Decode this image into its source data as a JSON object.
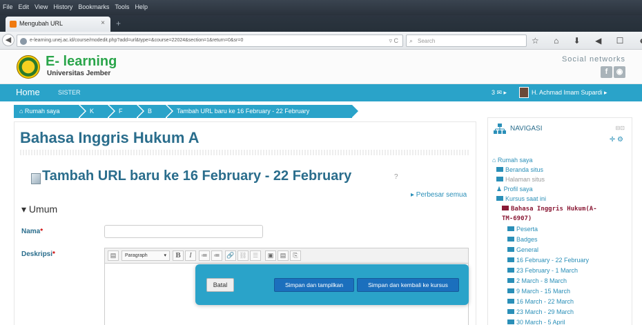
{
  "browser": {
    "menu": [
      "File",
      "Edit",
      "View",
      "History",
      "Bookmarks",
      "Tools",
      "Help"
    ],
    "tab_title": "Mengubah URL",
    "tab_close": "×",
    "new_tab": "+",
    "url": "e-learning.unej.ac.id/course/modedit.php?add=url&type=&course=22024&section=1&return=0&sr=0",
    "search_placeholder": "Search",
    "toolbar_icons": "☆ ⌂ ⬇ ◀ ☐ ☻ ≡"
  },
  "site": {
    "brand_title": "E- learning",
    "brand_subtitle": "Universitas Jember",
    "social_label": "Social networks",
    "social_icons": [
      "f",
      "◉"
    ]
  },
  "sitenav": {
    "home": "Home",
    "sister": "SISTER",
    "messages": "3 ✉ ▸",
    "user": "H. Achmad Imam Supardi ▸"
  },
  "breadcrumb": [
    "⌂ Rumah saya",
    "K",
    "F",
    "B",
    "Tambah URL baru ke 16 February - 22 February"
  ],
  "main": {
    "course_title": "Bahasa Inggris Hukum A",
    "page_title": "Tambah URL baru ke 16 February - 22 February",
    "help_icon": "?",
    "expand_all": "▸ Perbesar semua",
    "section_label": "▾ Umum",
    "name_label": "Nama",
    "desc_label": "Deskripsi",
    "required_mark": "*",
    "editor_format": "Paragraph",
    "editor_buttons": [
      "B",
      "I",
      "≔",
      "≔",
      "🔗",
      "⛓",
      "☰",
      "▣",
      "▤",
      "⎘"
    ]
  },
  "modal": {
    "cancel": "Batal",
    "save_display": "Simpan dan tampilkan",
    "save_return": "Simpan dan kembali ke kursus"
  },
  "navigation": {
    "header": "NAVIGASI",
    "controls": [
      "⊟⊡",
      "✛ ⚙"
    ],
    "items": [
      {
        "label": "⌂ Rumah saya"
      },
      {
        "label": "Beranda situs"
      },
      {
        "label": "Halaman situs"
      },
      {
        "label": "♟ Profil saya"
      },
      {
        "label": "Kursus saat ini"
      },
      {
        "label": "Bahasa Inggris Hukum(A-"
      },
      {
        "label": "TM-6907)"
      },
      {
        "label": "Peserta"
      },
      {
        "label": "Badges"
      },
      {
        "label": "General"
      },
      {
        "label": "16 February - 22 February"
      },
      {
        "label": "23 February - 1 March"
      },
      {
        "label": "2 March - 8 March"
      },
      {
        "label": "9 March - 15 March"
      },
      {
        "label": "16 March - 22 March"
      },
      {
        "label": "23 March - 29 March"
      },
      {
        "label": "30 March - 5 April"
      }
    ]
  }
}
